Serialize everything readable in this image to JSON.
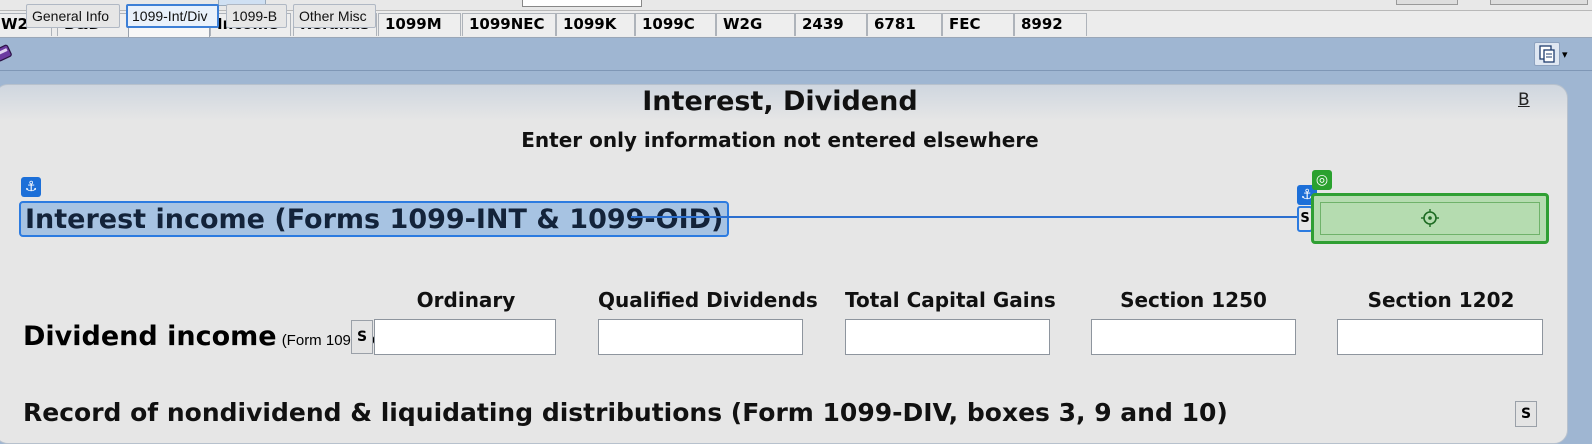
{
  "tabs": [
    {
      "label": "W2"
    },
    {
      "label": "B&D"
    },
    {
      "label": "Broker"
    },
    {
      "label": "Income"
    },
    {
      "label": "Refunds"
    },
    {
      "label": "1099M"
    },
    {
      "label": "1099NEC"
    },
    {
      "label": "1099K"
    },
    {
      "label": "1099C"
    },
    {
      "label": "W2G"
    },
    {
      "label": "2439"
    },
    {
      "label": "6781"
    },
    {
      "label": "FEC"
    },
    {
      "label": "8992"
    }
  ],
  "active_tab": "Broker",
  "subtabs": [
    {
      "label": "General Info"
    },
    {
      "label": "1099-Int/Div"
    },
    {
      "label": "1099-B"
    },
    {
      "label": "Other Misc"
    }
  ],
  "active_subtab": "1099-Int/Div",
  "form": {
    "title": "Interest, Dividend",
    "subtitle": "Enter only information not entered elsewhere",
    "b_link": "B",
    "anchor_glyph": "⚓",
    "target_glyph": "◎",
    "interest_label": "Interest income (Forms 1099-INT & 1099-OID)",
    "interest_s": "S",
    "dividend": {
      "label": "Dividend income",
      "sublabel": "(Form 1099-DI",
      "s": "S",
      "columns": [
        {
          "label": "Ordinary"
        },
        {
          "label": "Qualified Dividends"
        },
        {
          "label": "Total Capital Gains"
        },
        {
          "label": "Section 1250"
        },
        {
          "label": "Section 1202"
        }
      ]
    },
    "record_label": "Record of nondividend & liquidating distributions (Form 1099-DIV, boxes 3, 9 and 10)",
    "record_s": "S"
  },
  "colors": {
    "accent_blue": "#2c7be0",
    "field_green": "#2f9f33",
    "header_band": "#9fb6d2"
  }
}
